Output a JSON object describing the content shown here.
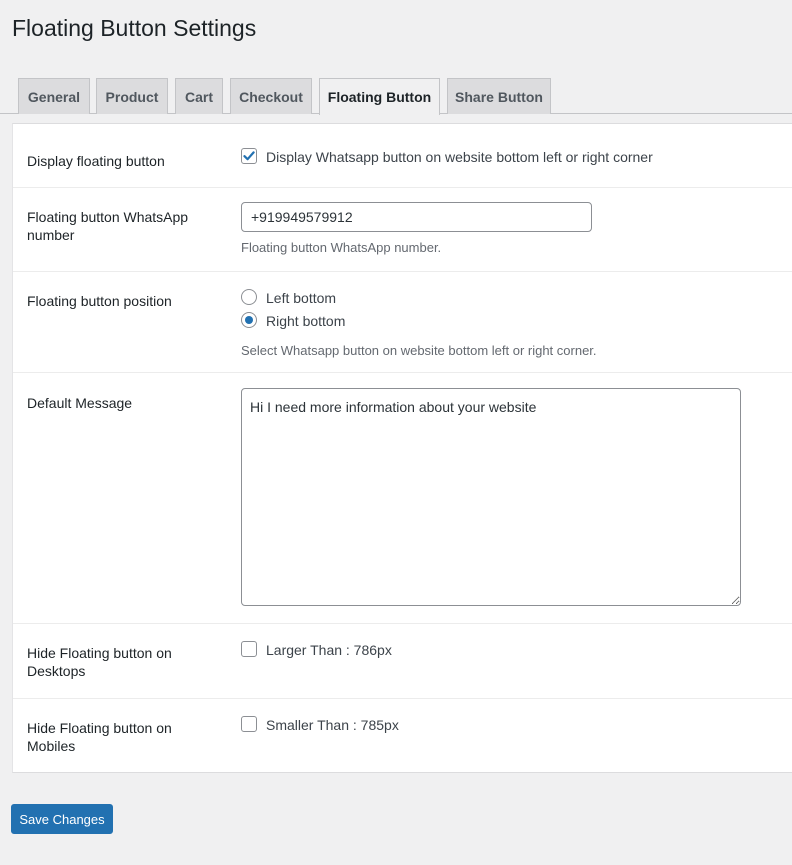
{
  "page": {
    "title": "Floating Button Settings"
  },
  "tabs": [
    {
      "label": "General"
    },
    {
      "label": "Product"
    },
    {
      "label": "Cart"
    },
    {
      "label": "Checkout"
    },
    {
      "label": "Floating Button",
      "active": true
    },
    {
      "label": "Share Button"
    }
  ],
  "settings": {
    "display": {
      "label": "Display floating button",
      "checkbox_label": "Display Whatsapp button on website bottom left or right corner",
      "checked": true
    },
    "number": {
      "label": "Floating button WhatsApp number",
      "value": "+919949579912",
      "description": "Floating button WhatsApp number."
    },
    "position": {
      "label": "Floating button position",
      "options": [
        {
          "label": "Left bottom",
          "checked": false
        },
        {
          "label": "Right bottom",
          "checked": true
        }
      ],
      "description": "Select Whatsapp button on website bottom left or right corner."
    },
    "message": {
      "label": "Default Message",
      "value": "Hi I need more information about your website"
    },
    "hide_desktop": {
      "label": "Hide Floating button on Desktops",
      "checkbox_label": "Larger Than : 786px",
      "checked": false
    },
    "hide_mobile": {
      "label": "Hide Floating button on Mobiles",
      "checkbox_label": "Smaller Than : 785px",
      "checked": false
    }
  },
  "actions": {
    "save_label": "Save Changes"
  },
  "colors": {
    "accent": "#2271b1",
    "background": "#f0f0f1",
    "panel": "#ffffff"
  }
}
